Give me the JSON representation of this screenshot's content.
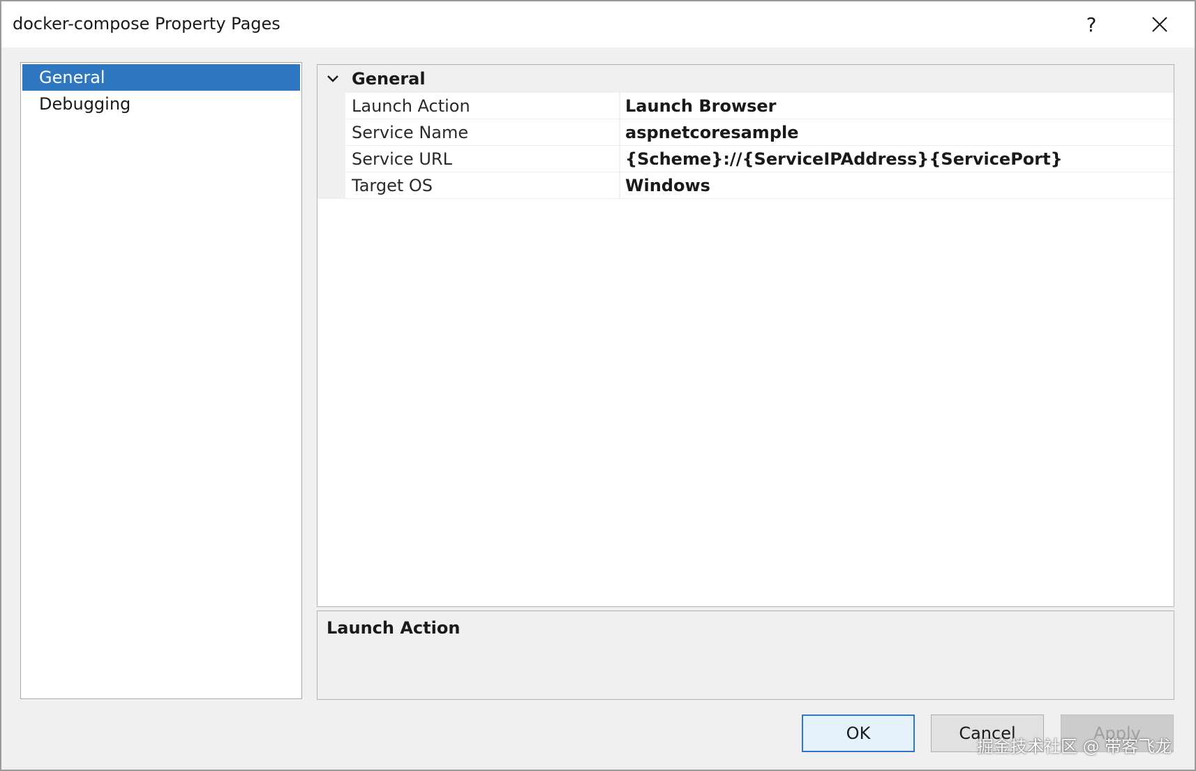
{
  "window": {
    "title": "docker-compose Property Pages",
    "help_label": "?"
  },
  "nav": {
    "items": [
      {
        "label": "General",
        "selected": true
      },
      {
        "label": "Debugging",
        "selected": false
      }
    ]
  },
  "grid": {
    "category": "General",
    "properties": [
      {
        "name": "Launch Action",
        "value": "Launch Browser"
      },
      {
        "name": "Service Name",
        "value": "aspnetcoresample"
      },
      {
        "name": "Service URL",
        "value": "{Scheme}://{ServiceIPAddress}{ServicePort}"
      },
      {
        "name": "Target OS",
        "value": "Windows"
      }
    ]
  },
  "description": {
    "title": "Launch Action"
  },
  "buttons": {
    "ok": "OK",
    "cancel": "Cancel",
    "apply": "Apply"
  },
  "watermark": "掘金技术社区 @ 带客飞龙",
  "colors": {
    "selection": "#2f77c1",
    "panel": "#f0f0f0"
  }
}
